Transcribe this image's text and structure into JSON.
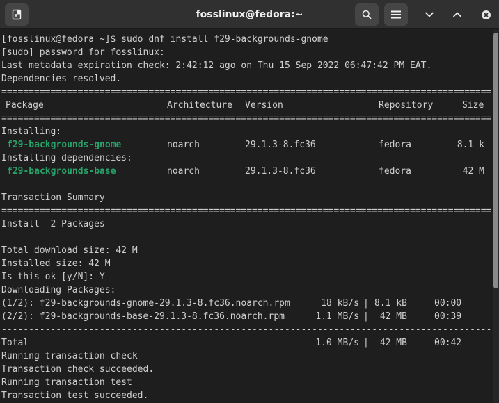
{
  "window": {
    "title": "fosslinux@fedora:~",
    "icons": [
      "new-tab-icon",
      "search-icon",
      "hamburger-menu-icon",
      "chevron-down-icon",
      "chevron-up-icon",
      "close-icon"
    ]
  },
  "terminal": {
    "prompt_line": "[fosslinux@fedora ~]$ sudo dnf install f29-backgrounds-gnome",
    "sudo_line": "[sudo] password for fosslinux:",
    "metadata_line": "Last metadata expiration check: 2:42:12 ago on Thu 15 Sep 2022 06:47:42 PM EAT.",
    "deps_line": "Dependencies resolved.",
    "separator_double": "========================================================================================================================",
    "separator_single": "------------------------------------------------------------------------------------------------------------------------",
    "headers": {
      "package": "Package",
      "architecture": "Architecture",
      "version": "Version",
      "repository": "Repository",
      "size": "Size"
    },
    "installing_label": "Installing:",
    "installing_deps_label": "Installing dependencies:",
    "packages": [
      {
        "name": "f29-backgrounds-gnome",
        "arch": "noarch",
        "version": "29.1.3-8.fc36",
        "repo": "fedora",
        "size": "8.1 k"
      },
      {
        "name": "f29-backgrounds-base",
        "arch": "noarch",
        "version": "29.1.3-8.fc36",
        "repo": "fedora",
        "size": "42 M"
      }
    ],
    "transaction_summary": "Transaction Summary",
    "install_count": "Install  2 Packages",
    "total_download": "Total download size: 42 M",
    "installed_size": "Installed size: 42 M",
    "confirm": "Is this ok [y/N]: Y",
    "downloading": "Downloading Packages:",
    "downloads": [
      {
        "file": "(1/2): f29-backgrounds-gnome-29.1.3-8.fc36.noarch.rpm",
        "speed": "18 kB/s",
        "size": "8.1 kB",
        "time": "00:00"
      },
      {
        "file": "(2/2): f29-backgrounds-base-29.1.3-8.fc36.noarch.rpm",
        "speed": "1.1 MB/s",
        "size": " 42 MB",
        "time": "00:39"
      }
    ],
    "total_label": "Total",
    "total_speed": "1.0 MB/s",
    "total_size": " 42 MB",
    "total_time": "00:42",
    "post_lines": [
      "Running transaction check",
      "Transaction check succeeded.",
      "Running transaction test",
      "Transaction test succeeded."
    ]
  },
  "colors": {
    "background": "#1e1e1e",
    "titlebar": "#303030",
    "text": "#d0d0d0",
    "package_name": "#26a269"
  }
}
